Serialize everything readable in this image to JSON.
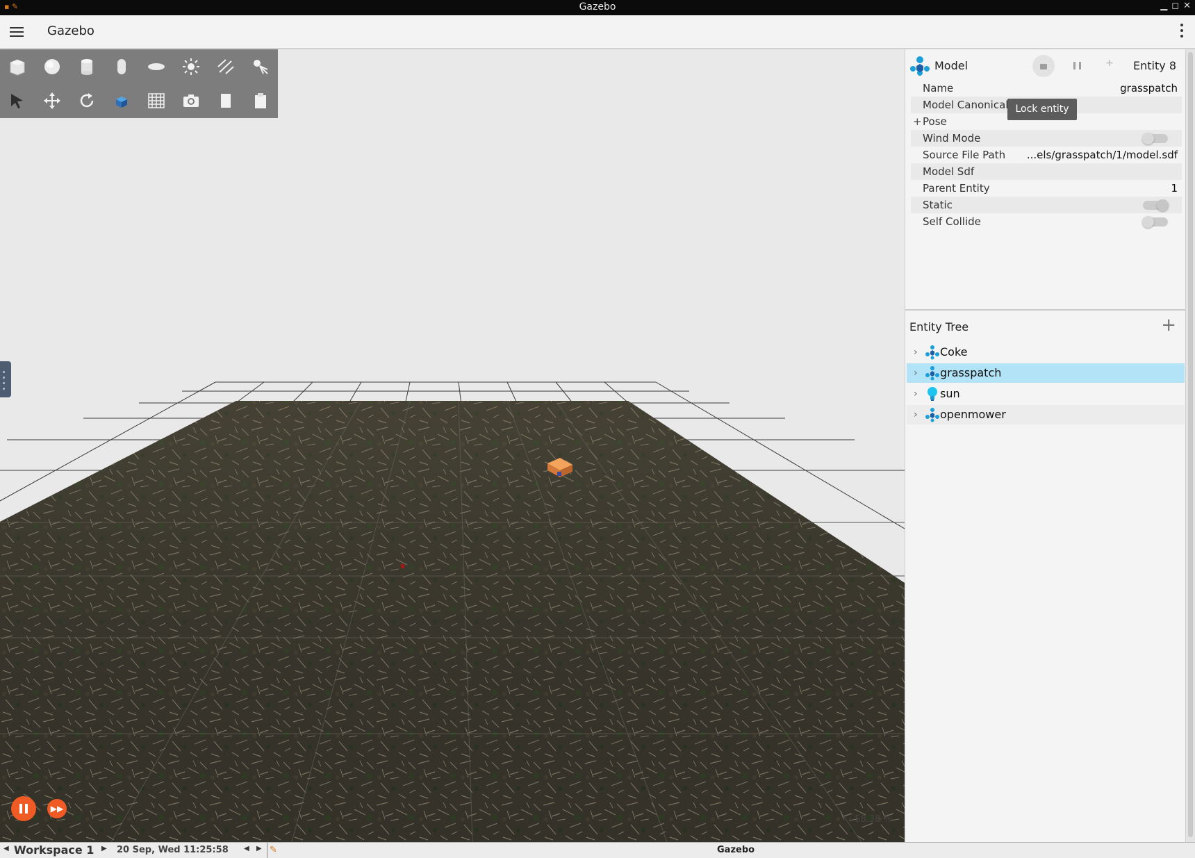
{
  "window": {
    "title": "Gazebo"
  },
  "header": {
    "title": "Gazebo"
  },
  "toolbar": {
    "row1": [
      "box-icon",
      "sphere-icon",
      "cylinder-icon",
      "capsule-icon",
      "ellipsoid-icon",
      "point-light-icon",
      "directional-light-icon",
      "spot-light-icon"
    ],
    "row2": [
      "select-icon",
      "translate-icon",
      "rotate-icon",
      "view-angle-icon",
      "grid-config-icon",
      "screenshot-icon",
      "copy-icon",
      "paste-icon"
    ]
  },
  "viewport": {
    "real_time_factor": "58.38 %"
  },
  "component_inspector": {
    "title": "Model",
    "entity_label": "Entity 8",
    "tooltip": "Lock entity",
    "properties": {
      "name": {
        "label": "Name",
        "value": "grasspatch"
      },
      "canonical_link": {
        "label": "Model Canonical Link",
        "value": ""
      },
      "pose": {
        "label": "Pose",
        "expander": "+"
      },
      "wind_mode": {
        "label": "Wind Mode",
        "value": false
      },
      "source_file_path": {
        "label": "Source File Path",
        "value": "...els/grasspatch/1/model.sdf"
      },
      "model_sdf": {
        "label": "Model Sdf"
      },
      "parent_entity": {
        "label": "Parent Entity",
        "value": "1"
      },
      "static": {
        "label": "Static",
        "value": true
      },
      "self_collide": {
        "label": "Self Collide",
        "value": false
      }
    }
  },
  "entity_tree": {
    "title": "Entity Tree",
    "items": [
      {
        "label": "Coke",
        "icon": "model-icon",
        "selected": false
      },
      {
        "label": "grasspatch",
        "icon": "model-icon",
        "selected": true
      },
      {
        "label": "sun",
        "icon": "light-icon",
        "selected": false
      },
      {
        "label": "openmower",
        "icon": "model-icon",
        "selected": false
      }
    ]
  },
  "taskbar": {
    "workspace": "Workspace 1",
    "datetime": "20 Sep, Wed 11:25:58",
    "active_window": "Gazebo"
  },
  "colors": {
    "accent_orange": "#f05a24",
    "selection_blue": "#b3e3f7",
    "toolbar_gray": "#7d7d7d",
    "model_icon_blue": "#1a9fd8"
  }
}
